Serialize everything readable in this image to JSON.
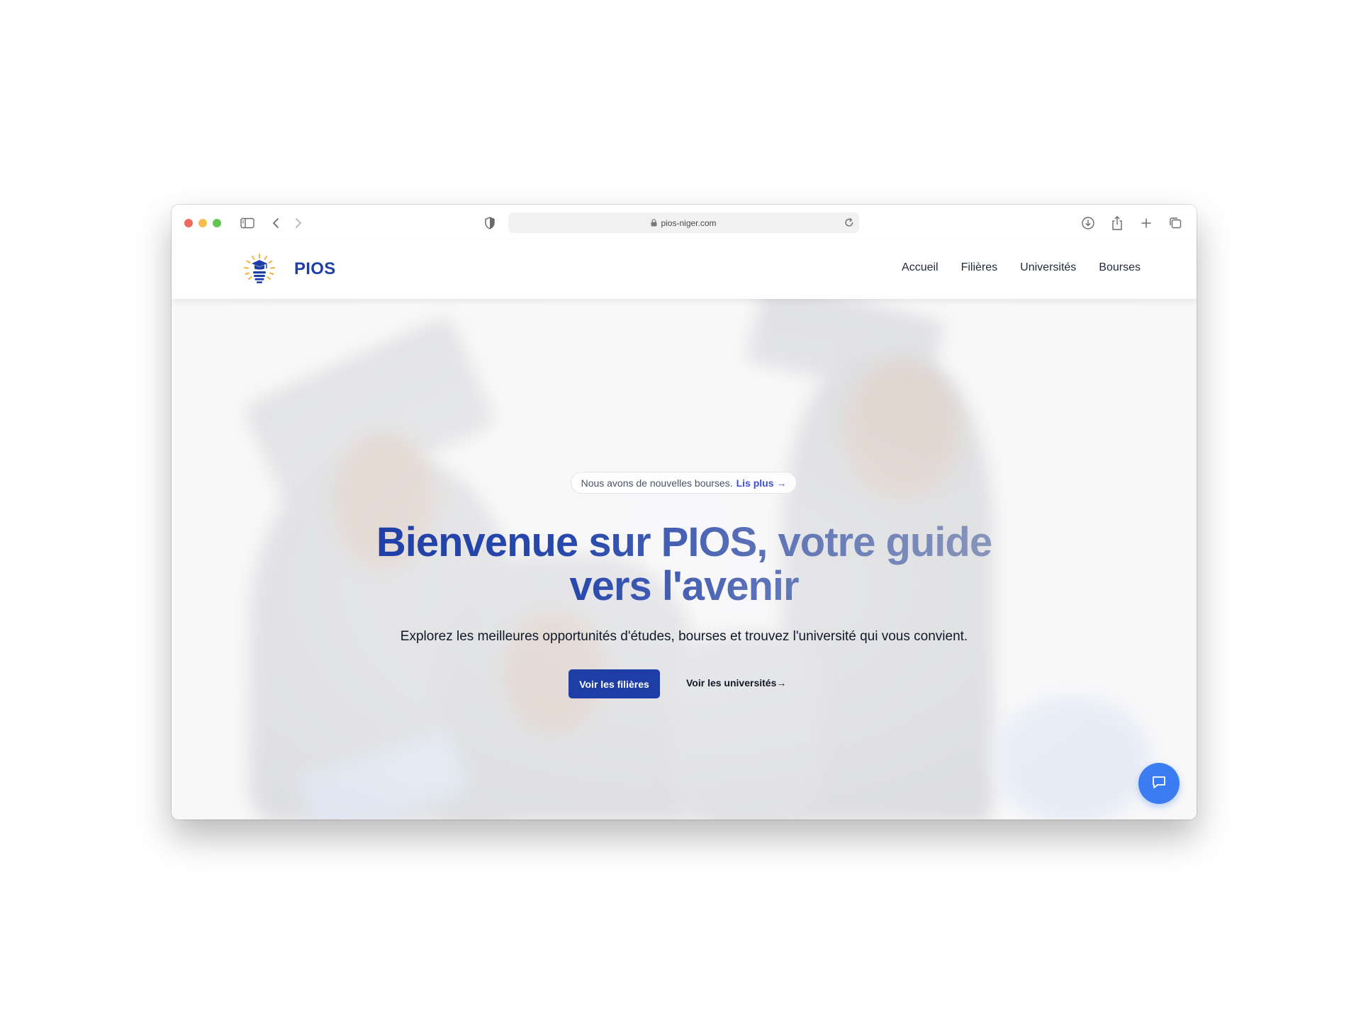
{
  "browser": {
    "url": "pios-niger.com"
  },
  "site": {
    "brand": "PIOS",
    "nav": [
      "Accueil",
      "Filières",
      "Universités",
      "Bourses"
    ]
  },
  "hero": {
    "announcement": "Nous avons de nouvelles bourses.",
    "announcement_link": "Lis plus →",
    "title_line1": "Bienvenue sur PIOS, votre guide",
    "title_line2": "vers l'avenir",
    "subtitle": "Explorez les meilleures opportunités d'études, bourses et trouvez l'université qui vous convient.",
    "primary_button": "Voir les filières",
    "secondary_link": "Voir les universités→"
  },
  "colors": {
    "brand_blue": "#1e3ea6",
    "chat_blue": "#3b7cf2"
  },
  "icons": {
    "chat": "chat-bubble-icon",
    "logo": "graduation-bulb-logo"
  }
}
